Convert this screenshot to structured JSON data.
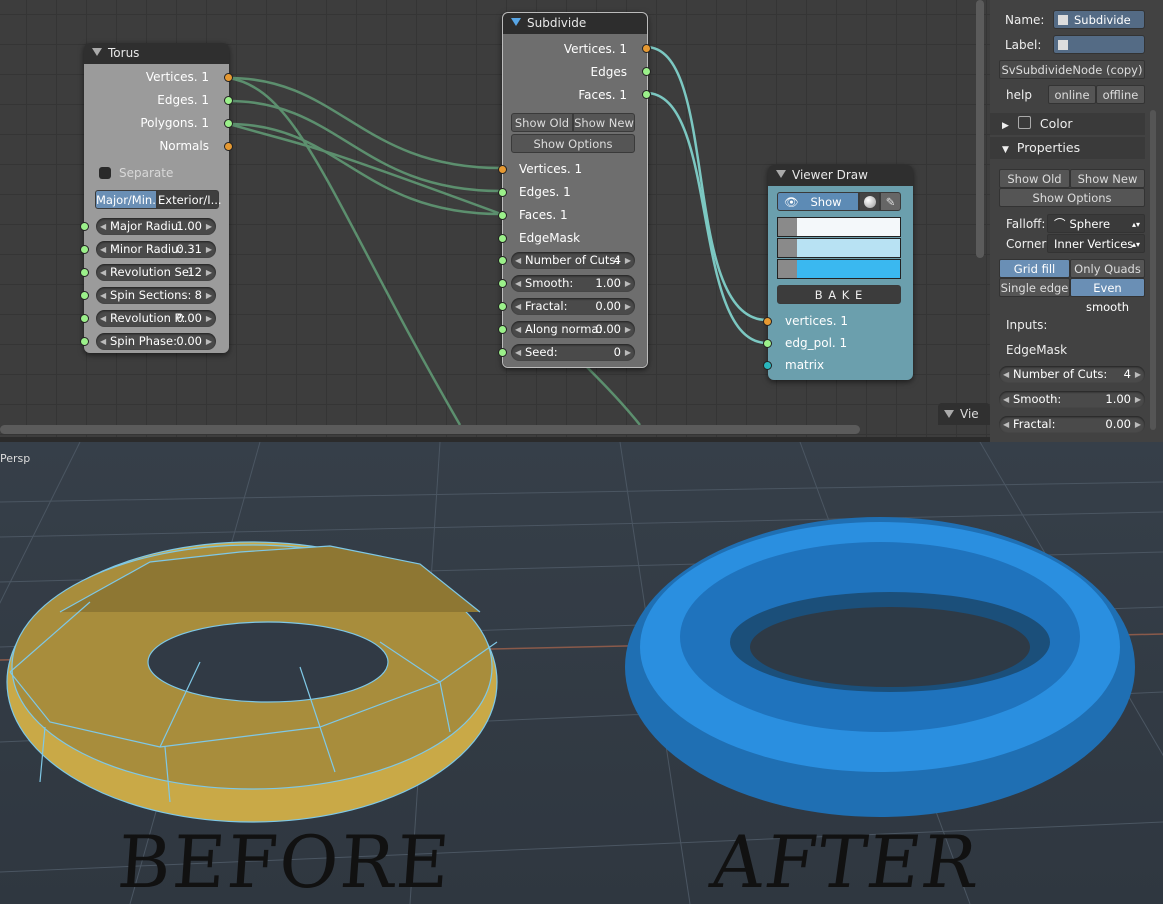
{
  "torus_node": {
    "title": "Torus",
    "outputs": [
      "Vertices. 1",
      "Edges. 1",
      "Polygons. 1",
      "Normals"
    ],
    "separate_label": "Separate",
    "modes": [
      "Major/Min...",
      "Exterior/I..."
    ],
    "fields": [
      {
        "name": "Major Radiu:",
        "value": "1.00"
      },
      {
        "name": "Minor Radiu:",
        "value": "0.31"
      },
      {
        "name": "Revolution Se:",
        "value": "12"
      },
      {
        "name": "Spin Sections:",
        "value": "8"
      },
      {
        "name": "Revolution P:",
        "value": "0.00"
      },
      {
        "name": "Spin Phase:",
        "value": "0.00"
      }
    ]
  },
  "subdivide_node": {
    "title": "Subdivide",
    "outputs": [
      "Vertices. 1",
      "Edges",
      "Faces. 1"
    ],
    "show_old": "Show Old",
    "show_new": "Show New",
    "show_options": "Show Options",
    "inputs": [
      "Vertices. 1",
      "Edges. 1",
      "Faces. 1",
      "EdgeMask"
    ],
    "fields": [
      {
        "name": "Number of Cuts:",
        "value": "4"
      },
      {
        "name": "Smooth:",
        "value": "1.00"
      },
      {
        "name": "Fractal:",
        "value": "0.00"
      },
      {
        "name": "Along norma:",
        "value": "0.00"
      },
      {
        "name": "Seed:",
        "value": "0"
      }
    ]
  },
  "viewer_node": {
    "title": "Viewer Draw",
    "show_label": "Show",
    "bake_label": "B A K E",
    "inputs": [
      "vertices. 1",
      "edg_pol. 1",
      "matrix"
    ],
    "swatch_colors": [
      "#f4f8fa",
      "#b8e2f3",
      "#3ab8f0"
    ]
  },
  "bottom_node_stub": {
    "title": "Vie"
  },
  "panel": {
    "name_label": "Name:",
    "name_value": "Subdivide",
    "label_label": "Label:",
    "label_value": "",
    "node_id": "SvSubdivideNode (copy)",
    "help_label": "help",
    "online": "online",
    "offline": "offline",
    "color_section": "Color",
    "properties_section": "Properties",
    "show_old": "Show Old",
    "show_new": "Show New",
    "show_options": "Show Options",
    "falloff_label": "Falloff:",
    "falloff_value": "Sphere",
    "corner_label": "Corner",
    "corner_value": "Inner Vertices",
    "grid_fill": "Grid fill",
    "only_quads": "Only Quads",
    "single_edge": "Single edge",
    "even_smooth": "Even smooth",
    "inputs_label": "Inputs:",
    "edgemask_label": "EdgeMask",
    "fields": [
      {
        "name": "Number of Cuts:",
        "value": "4"
      },
      {
        "name": "Smooth:",
        "value": "1.00"
      },
      {
        "name": "Fractal:",
        "value": "0.00"
      }
    ]
  },
  "viewport": {
    "view_label": "Persp",
    "before_text": "BEFORE",
    "after_text": "AFTER",
    "before_color": "#d4b24e",
    "after_color": "#2a8fe0"
  }
}
